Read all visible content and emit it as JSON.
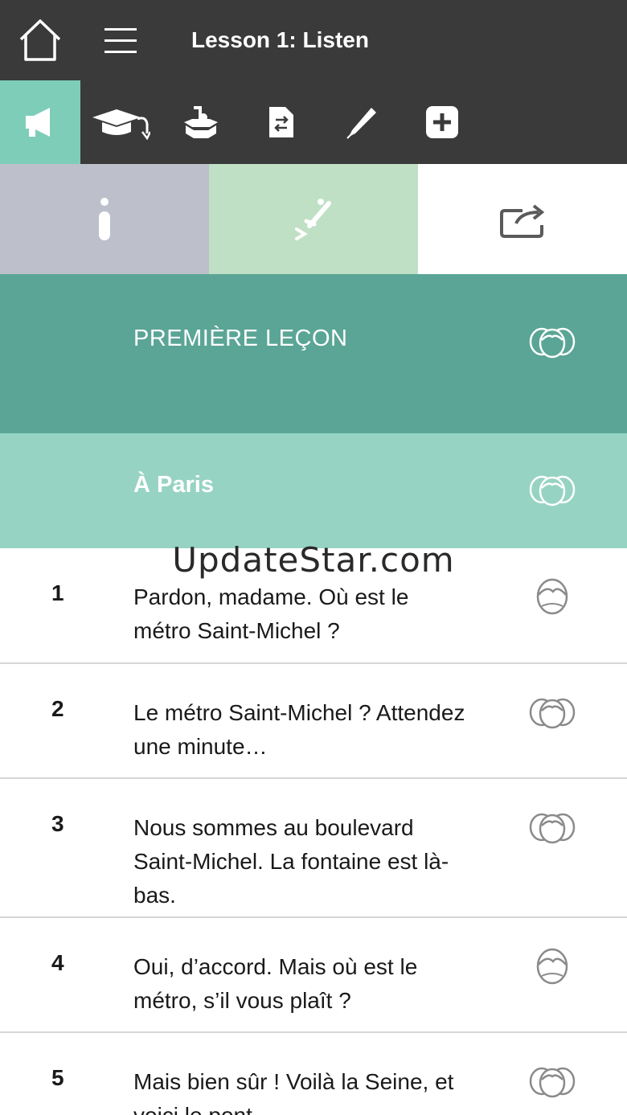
{
  "header": {
    "title": "Lesson 1: Listen",
    "home_icon": "home-icon",
    "menu_icon": "hamburger-menu-icon"
  },
  "toolbar": {
    "items": [
      {
        "icon": "megaphone-icon",
        "active": true
      },
      {
        "icon": "graduation-cap-icon",
        "active": false
      },
      {
        "icon": "ballot-box-icon",
        "active": false
      },
      {
        "icon": "document-swap-icon",
        "active": false
      },
      {
        "icon": "pen-icon",
        "active": false
      },
      {
        "icon": "plus-icon",
        "active": false
      }
    ]
  },
  "segments": [
    {
      "icon": "info-icon"
    },
    {
      "icon": "check-slider-icon"
    },
    {
      "icon": "share-icon"
    }
  ],
  "lesson": {
    "title": "PREMIÈRE LEÇON",
    "subtitle": "À Paris"
  },
  "watermark": "UpdateStar.com",
  "dialogue": [
    {
      "num": "1",
      "text": "Pardon, madame. Où est le métro Saint-Michel ?",
      "speaker_icon": "woman-face-icon"
    },
    {
      "num": "2",
      "text": "Le métro Saint-Michel ? Attendez une minute…",
      "speaker_icon": "group-faces-icon"
    },
    {
      "num": "3",
      "text": "Nous sommes au boulevard Saint-Michel. La fontaine est là-bas.",
      "speaker_icon": "group-faces-icon"
    },
    {
      "num": "4",
      "text": "Oui, d’accord. Mais où est le métro, s’il vous plaît ?",
      "speaker_icon": "woman-face-icon"
    },
    {
      "num": "5",
      "text": "Mais bien sûr ! Voilà la Seine, et voici le pont.",
      "speaker_icon": "group-faces-icon"
    }
  ],
  "colors": {
    "topbar": "#3a3a3a",
    "active_tool": "#7ecdb8",
    "lesson_header": "#5aa596",
    "subheader": "#97d3c2",
    "seg_info": "#bdbfca",
    "seg_practice": "#bfe0c4"
  }
}
